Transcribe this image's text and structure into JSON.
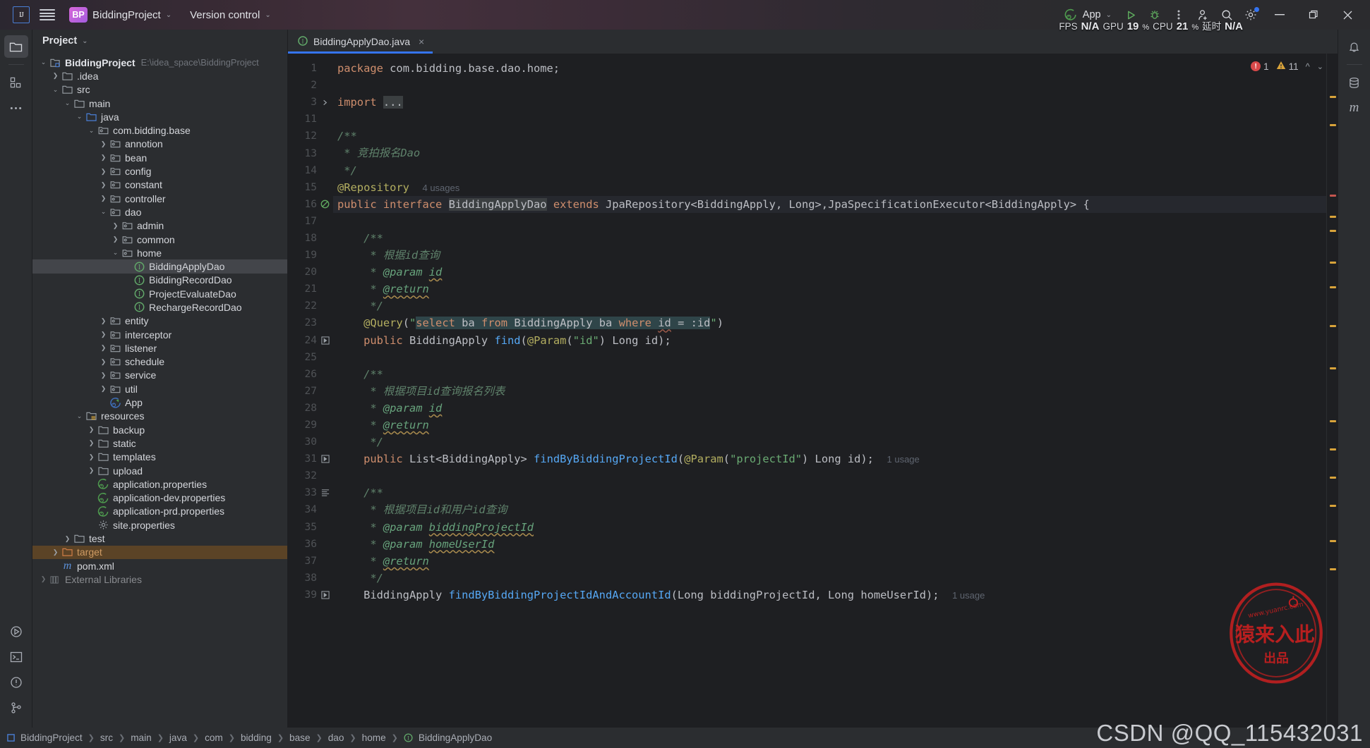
{
  "titlebar": {
    "app_icon": "intellij-idea-logo",
    "menu_icon": "hamburger-menu-icon",
    "project_badge": "BP",
    "project_name": "BiddingProject",
    "version_control": "Version control",
    "run_config": "App",
    "run_icon": "run-icon",
    "debug_icon": "debug-icon",
    "more_icon": "more-vertical-icon",
    "account_icon": "account-icon",
    "search_icon": "search-icon",
    "settings_icon": "settings-gear-icon",
    "minimize": "minimize-icon",
    "maximize": "maximize-icon",
    "close": "close-icon"
  },
  "perf": {
    "fps_label": "FPS",
    "fps_value": "N/A",
    "gpu_label": "GPU",
    "gpu_value": "19",
    "gpu_unit": "%",
    "cpu_label": "CPU",
    "cpu_value": "21",
    "cpu_unit": "%",
    "lat_label": "延时",
    "lat_value": "N/A"
  },
  "leftrail": {
    "items": [
      {
        "name": "project-tool-icon",
        "glyph": "folder"
      },
      {
        "name": "structure-tool-icon",
        "glyph": "blocks"
      },
      {
        "name": "more-tool-windows-icon",
        "glyph": "dots"
      }
    ],
    "bottom": [
      {
        "name": "run-tool-icon",
        "glyph": "play-circle"
      },
      {
        "name": "terminal-tool-icon",
        "glyph": "terminal"
      },
      {
        "name": "problems-tool-icon",
        "glyph": "warning-circle"
      },
      {
        "name": "version-control-tool-icon",
        "glyph": "branch"
      }
    ]
  },
  "rightrail": {
    "items": [
      {
        "name": "notifications-icon",
        "glyph": "bell"
      },
      {
        "name": "database-tool-icon",
        "glyph": "database"
      },
      {
        "name": "maven-tool-icon",
        "glyph": "m"
      }
    ]
  },
  "project_panel": {
    "title": "Project",
    "tree": [
      {
        "depth": 0,
        "arrow": "down",
        "icon": "module",
        "label": "BiddingProject",
        "bold": true,
        "path": "E:\\idea_space\\BiddingProject"
      },
      {
        "depth": 1,
        "arrow": "right",
        "icon": "folder",
        "label": ".idea"
      },
      {
        "depth": 1,
        "arrow": "down",
        "icon": "folder",
        "label": "src"
      },
      {
        "depth": 2,
        "arrow": "down",
        "icon": "folder",
        "label": "main"
      },
      {
        "depth": 3,
        "arrow": "down",
        "icon": "source-folder",
        "label": "java"
      },
      {
        "depth": 4,
        "arrow": "down",
        "icon": "package",
        "label": "com.bidding.base"
      },
      {
        "depth": 5,
        "arrow": "right",
        "icon": "package",
        "label": "annotion"
      },
      {
        "depth": 5,
        "arrow": "right",
        "icon": "package",
        "label": "bean"
      },
      {
        "depth": 5,
        "arrow": "right",
        "icon": "package",
        "label": "config"
      },
      {
        "depth": 5,
        "arrow": "right",
        "icon": "package",
        "label": "constant"
      },
      {
        "depth": 5,
        "arrow": "right",
        "icon": "package",
        "label": "controller"
      },
      {
        "depth": 5,
        "arrow": "down",
        "icon": "package",
        "label": "dao"
      },
      {
        "depth": 6,
        "arrow": "right",
        "icon": "package",
        "label": "admin"
      },
      {
        "depth": 6,
        "arrow": "right",
        "icon": "package",
        "label": "common"
      },
      {
        "depth": 6,
        "arrow": "down",
        "icon": "package",
        "label": "home"
      },
      {
        "depth": 7,
        "arrow": "none",
        "icon": "interface",
        "label": "BiddingApplyDao",
        "selected": true
      },
      {
        "depth": 7,
        "arrow": "none",
        "icon": "interface",
        "label": "BiddingRecordDao"
      },
      {
        "depth": 7,
        "arrow": "none",
        "icon": "interface",
        "label": "ProjectEvaluateDao"
      },
      {
        "depth": 7,
        "arrow": "none",
        "icon": "interface",
        "label": "RechargeRecordDao"
      },
      {
        "depth": 5,
        "arrow": "right",
        "icon": "package",
        "label": "entity"
      },
      {
        "depth": 5,
        "arrow": "right",
        "icon": "package",
        "label": "interceptor"
      },
      {
        "depth": 5,
        "arrow": "right",
        "icon": "package",
        "label": "listener"
      },
      {
        "depth": 5,
        "arrow": "right",
        "icon": "package",
        "label": "schedule"
      },
      {
        "depth": 5,
        "arrow": "right",
        "icon": "package",
        "label": "service"
      },
      {
        "depth": 5,
        "arrow": "right",
        "icon": "package",
        "label": "util"
      },
      {
        "depth": 5,
        "arrow": "none",
        "icon": "spring-class",
        "label": "App"
      },
      {
        "depth": 3,
        "arrow": "down",
        "icon": "resources-folder",
        "label": "resources"
      },
      {
        "depth": 4,
        "arrow": "right",
        "icon": "folder",
        "label": "backup"
      },
      {
        "depth": 4,
        "arrow": "right",
        "icon": "folder",
        "label": "static"
      },
      {
        "depth": 4,
        "arrow": "right",
        "icon": "folder",
        "label": "templates"
      },
      {
        "depth": 4,
        "arrow": "right",
        "icon": "folder",
        "label": "upload"
      },
      {
        "depth": 4,
        "arrow": "none",
        "icon": "spring-properties",
        "label": "application.properties"
      },
      {
        "depth": 4,
        "arrow": "none",
        "icon": "spring-properties",
        "label": "application-dev.properties"
      },
      {
        "depth": 4,
        "arrow": "none",
        "icon": "spring-properties",
        "label": "application-prd.properties"
      },
      {
        "depth": 4,
        "arrow": "none",
        "icon": "properties",
        "label": "site.properties"
      },
      {
        "depth": 2,
        "arrow": "right",
        "icon": "folder",
        "label": "test"
      },
      {
        "depth": 1,
        "arrow": "right",
        "icon": "target-folder",
        "label": "target",
        "target": true
      },
      {
        "depth": 1,
        "arrow": "none",
        "icon": "maven",
        "label": "pom.xml"
      },
      {
        "depth": 0,
        "arrow": "right",
        "icon": "libraries",
        "label": "External Libraries",
        "cut": true
      }
    ]
  },
  "editor": {
    "tab": {
      "label": "BiddingApplyDao.java",
      "icon": "interface-icon",
      "close": "×"
    },
    "inspection": {
      "errors": "1",
      "warnings": "11",
      "up": "^",
      "down": "v"
    },
    "lines": [
      {
        "n": "1",
        "gmark": "",
        "html": "<span class=\"kw\">package</span> <span class=\"plain\">com.bidding.base.dao.home;</span>"
      },
      {
        "n": "2",
        "gmark": "",
        "html": ""
      },
      {
        "n": "3",
        "gmark": "fold",
        "html": "<span class=\"kw\">import</span> <span class=\"hl-ident plain\">...</span>"
      },
      {
        "n": "11",
        "gmark": "",
        "html": ""
      },
      {
        "n": "12",
        "gmark": "",
        "html": "<span class=\"cmt-i\">/**</span>"
      },
      {
        "n": "13",
        "gmark": "",
        "html": "<span class=\"cmt-i\"> * 竞拍报名Dao</span>"
      },
      {
        "n": "14",
        "gmark": "",
        "html": "<span class=\"cmt-i\"> */</span>"
      },
      {
        "n": "15",
        "gmark": "",
        "html": "<span class=\"ann\">@Repository</span>  <span class=\"usg\">4 usages</span>"
      },
      {
        "n": "16",
        "gmark": "impl",
        "current": true,
        "html": "<span class=\"kw\">public</span> <span class=\"kw\">interface</span> <span class=\"hl-ident cls\">BiddingApplyDao</span> <span class=\"kw\">extends</span> <span class=\"cls\">JpaRepository</span><span class=\"plain\">&lt;BiddingApply, Long&gt;,</span><span class=\"cls\">JpaSpecificationExecutor</span><span class=\"plain\">&lt;BiddingApply&gt; {</span>"
      },
      {
        "n": "17",
        "gmark": "",
        "html": ""
      },
      {
        "n": "18",
        "gmark": "",
        "html": "    <span class=\"cmt-i\">/**</span>"
      },
      {
        "n": "19",
        "gmark": "",
        "html": "     <span class=\"cmt-i\">* 根据id查询</span>"
      },
      {
        "n": "20",
        "gmark": "",
        "html": "     <span class=\"cmt-i\">* </span><span class=\"doc-tag\">@param</span> <span class=\"doc-tag wavy\">id</span>"
      },
      {
        "n": "21",
        "gmark": "",
        "html": "     <span class=\"cmt-i\">* </span><span class=\"doc-tag wavy\">@return</span>"
      },
      {
        "n": "22",
        "gmark": "",
        "html": "     <span class=\"cmt-i\">*/</span>"
      },
      {
        "n": "23",
        "gmark": "",
        "html": "    <span class=\"ann\">@Query</span><span class=\"plain\">(</span><span class=\"str\">\"</span><span class=\"hl-sql\"><span class=\"kw\">select</span> <span class=\"plain\">ba</span> <span class=\"kw\">from</span> <span class=\"plain\">BiddingApply ba</span> <span class=\"kw\">where</span> <span class=\"plain wavy-r\">id</span> <span class=\"plain\">= :id</span></span><span class=\"str\">\"</span><span class=\"plain\">)</span>"
      },
      {
        "n": "24",
        "gmark": "over",
        "html": "    <span class=\"kw\">public</span> <span class=\"cls\">BiddingApply</span> <span class=\"mth\">find</span><span class=\"plain\">(</span><span class=\"ann\">@Param</span><span class=\"plain\">(</span><span class=\"str\">\"id\"</span><span class=\"plain\">) Long id);</span>"
      },
      {
        "n": "25",
        "gmark": "",
        "html": ""
      },
      {
        "n": "26",
        "gmark": "",
        "html": "    <span class=\"cmt-i\">/**</span>"
      },
      {
        "n": "27",
        "gmark": "",
        "html": "     <span class=\"cmt-i\">* 根据项目id查询报名列表</span>"
      },
      {
        "n": "28",
        "gmark": "",
        "html": "     <span class=\"cmt-i\">* </span><span class=\"doc-tag\">@param</span> <span class=\"doc-tag wavy\">id</span>"
      },
      {
        "n": "29",
        "gmark": "",
        "html": "     <span class=\"cmt-i\">* </span><span class=\"doc-tag wavy\">@return</span>"
      },
      {
        "n": "30",
        "gmark": "",
        "html": "     <span class=\"cmt-i\">*/</span>"
      },
      {
        "n": "31",
        "gmark": "over",
        "html": "    <span class=\"kw\">public</span> <span class=\"cls\">List</span><span class=\"plain\">&lt;BiddingApply&gt; </span><span class=\"mth\">findByBiddingProjectId</span><span class=\"plain\">(</span><span class=\"ann\">@Param</span><span class=\"plain\">(</span><span class=\"str\">\"projectId\"</span><span class=\"plain\">) Long id);</span>  <span class=\"usg\">1 usage</span>"
      },
      {
        "n": "32",
        "gmark": "",
        "html": ""
      },
      {
        "n": "33",
        "gmark": "doc",
        "html": "    <span class=\"cmt-i\">/**</span>"
      },
      {
        "n": "34",
        "gmark": "",
        "html": "     <span class=\"cmt-i\">* 根据项目id和用户id查询</span>"
      },
      {
        "n": "35",
        "gmark": "",
        "html": "     <span class=\"cmt-i\">* </span><span class=\"doc-tag\">@param</span> <span class=\"doc-tag wavy\">biddingProjectId</span>"
      },
      {
        "n": "36",
        "gmark": "",
        "html": "     <span class=\"cmt-i\">* </span><span class=\"doc-tag\">@param</span> <span class=\"doc-tag wavy\">homeUserId</span>"
      },
      {
        "n": "37",
        "gmark": "",
        "html": "     <span class=\"cmt-i\">* </span><span class=\"doc-tag wavy\">@return</span>"
      },
      {
        "n": "38",
        "gmark": "",
        "html": "     <span class=\"cmt-i\">*/</span>"
      },
      {
        "n": "39",
        "gmark": "over",
        "html": "    <span class=\"cls\">BiddingApply</span> <span class=\"mth\">findByBiddingProjectIdAndAccountId</span><span class=\"plain\">(Long biddingProjectId, Long homeUserId);</span>  <span class=\"usg\">1 usage</span>"
      }
    ]
  },
  "statusbar": {
    "breadcrumb": [
      "BiddingProject",
      "src",
      "main",
      "java",
      "com",
      "bidding",
      "base",
      "dao",
      "home",
      "BiddingApplyDao"
    ],
    "module_icon": "module-icon",
    "interface_icon": "interface-icon"
  },
  "watermark": {
    "csdn": "CSDN @QQ_115432031",
    "stamp_site": "www.yuanrc.com",
    "stamp_main": "猿来入此",
    "stamp_sub": "出品"
  }
}
